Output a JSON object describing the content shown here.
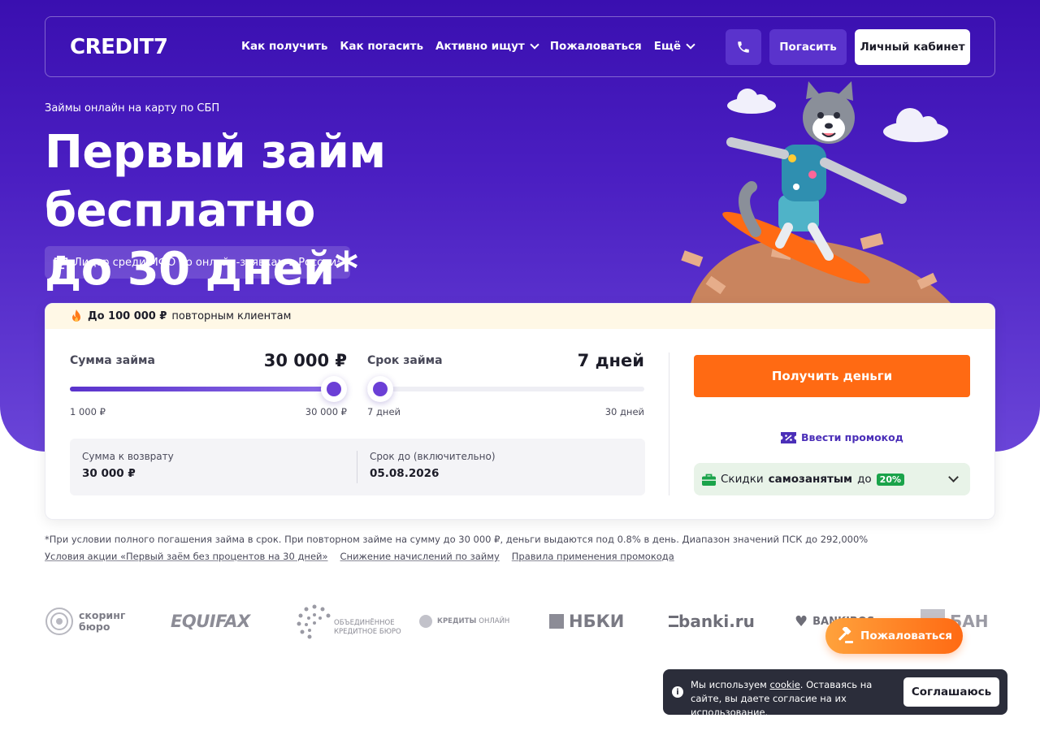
{
  "header": {
    "logo": "CREDIT7",
    "nav": [
      {
        "label": "Как получить"
      },
      {
        "label": "Как погасить"
      },
      {
        "label": "Активно ищут"
      },
      {
        "label": "Пожаловаться"
      },
      {
        "label": "Ещё"
      }
    ],
    "pay_label": "Погасить",
    "cabinet_label": "Личный кабинет"
  },
  "hero": {
    "subtitle": "Займы онлайн на карту по СБП",
    "title_line1": "Первый займ бесплатно",
    "title_line2": "до 30 дней*",
    "leader_badge": "Лидер среди МФО по онлайн-заявкам в России¹"
  },
  "calculator": {
    "promo_strip_bold": "До 100 000 ₽",
    "promo_strip_rest": "повторным клиентам",
    "amount": {
      "label": "Сумма займа",
      "value": "30 000 ₽",
      "min": "1 000 ₽",
      "max": "30 000 ₽",
      "fraction": 1.0
    },
    "term": {
      "label": "Срок займа",
      "value": "7 дней",
      "min": "7 дней",
      "max": "30 дней",
      "fraction": 0.0
    },
    "summary": {
      "return_label": "Сумма к возврату",
      "return_value": "30 000 ₽",
      "due_label": "Срок до (включительно)",
      "due_value": "05.08.2026"
    },
    "get_money_label": "Получить деньги",
    "promo_code_label": "Ввести промокод",
    "self_employed": {
      "prefix": "Скидки",
      "bold": "самозанятым",
      "mid": "до",
      "badge": "20%"
    }
  },
  "footnote": "*При условии полного погашения займа в срок. При повторном займе на сумму до 30 000 ₽, деньги выдаются под 0.8% в день. Диапазон значений ПСК до 292,000%",
  "links": [
    "Условия акции «Первый заём без процентов на 30 дней»",
    "Снижение начислений по займу",
    "Правила применения промокода"
  ],
  "partners": {
    "scoring_line1": "скоринг",
    "scoring_line2": "бюро",
    "equifax": "EQUIFAX",
    "okb_line1": "ОБЪЕДИНЁННОЕ",
    "okb_line2": "КРЕДИТНОЕ БЮРО",
    "credits_online_bold": "КРЕДИТЫ",
    "credits_online_light": "ОНЛАЙН",
    "nbki": "НБКИ",
    "banki": "banki.ru",
    "bankiros": "BANKIROS",
    "ban": "БАН"
  },
  "complain_button": "Пожаловаться",
  "cookie": {
    "text_before": "Мы используем",
    "link": "cookie",
    "text_after": ". Оставаясь на сайте, вы даете согласие на их использование.",
    "accept": "Соглашаюсь"
  },
  "colors": {
    "brand_purple": "#4b1fc2",
    "accent_orange": "#ff6a13",
    "green_badge": "#1aa34a"
  }
}
